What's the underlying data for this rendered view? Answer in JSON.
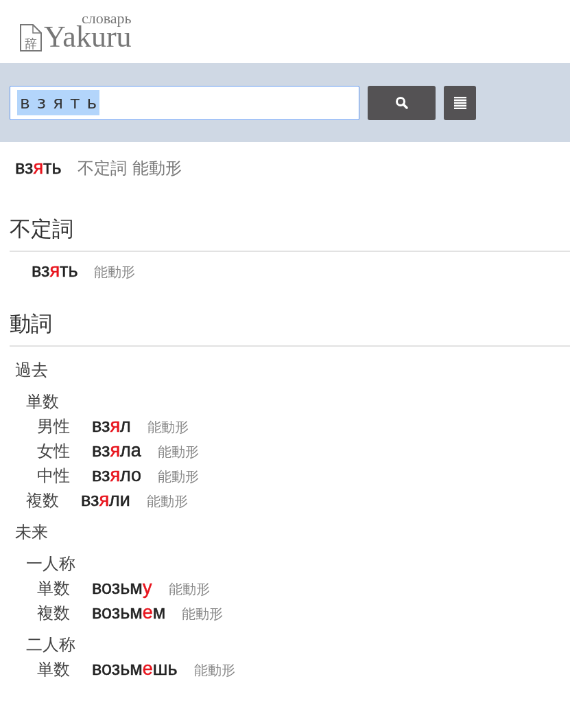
{
  "logo": {
    "icon_char": "辞",
    "title": "Yakuru",
    "subtitle": "словарь"
  },
  "search": {
    "value": "в з я т ь",
    "selected": true
  },
  "headword": {
    "word": {
      "before": "вз",
      "stress": "я",
      "after": "ть"
    },
    "tags": "不定詞 能動形"
  },
  "sections": [
    {
      "title": "不定詞",
      "items": [
        {
          "kind": "form",
          "word": {
            "before": "вз",
            "stress": "я",
            "after": "ть"
          },
          "tag": "能動形"
        }
      ]
    },
    {
      "title": "動詞",
      "items": [
        {
          "kind": "group",
          "label": "過去",
          "children": [
            {
              "kind": "group",
              "label": "単数",
              "children": [
                {
                  "kind": "form",
                  "label": "男性",
                  "word": {
                    "before": "вз",
                    "stress": "я",
                    "after": "л"
                  },
                  "tag": "能動形"
                },
                {
                  "kind": "form",
                  "label": "女性",
                  "word": {
                    "before": "вз",
                    "stress": "я",
                    "after": "ла"
                  },
                  "tag": "能動形"
                },
                {
                  "kind": "form",
                  "label": "中性",
                  "word": {
                    "before": "вз",
                    "stress": "я",
                    "after": "ло"
                  },
                  "tag": "能動形"
                }
              ]
            },
            {
              "kind": "form",
              "label": "複数",
              "word": {
                "before": "вз",
                "stress": "я",
                "after": "ли"
              },
              "tag": "能動形"
            }
          ]
        },
        {
          "kind": "group",
          "label": "未来",
          "children": [
            {
              "kind": "group",
              "label": "一人称",
              "children": [
                {
                  "kind": "form",
                  "label": "単数",
                  "word": {
                    "before": "возьм",
                    "stress": "у"
                  },
                  "tag": "能動形"
                },
                {
                  "kind": "form",
                  "label": "複数",
                  "word": {
                    "before": "возьм",
                    "stress": "е",
                    "after": "м"
                  },
                  "tag": "能動形"
                }
              ]
            },
            {
              "kind": "group",
              "label": "二人称",
              "children": [
                {
                  "kind": "form",
                  "label": "単数",
                  "word": {
                    "before": "возьм",
                    "stress": "е",
                    "after": "шь"
                  },
                  "tag": "能動形"
                }
              ]
            }
          ]
        }
      ]
    }
  ]
}
